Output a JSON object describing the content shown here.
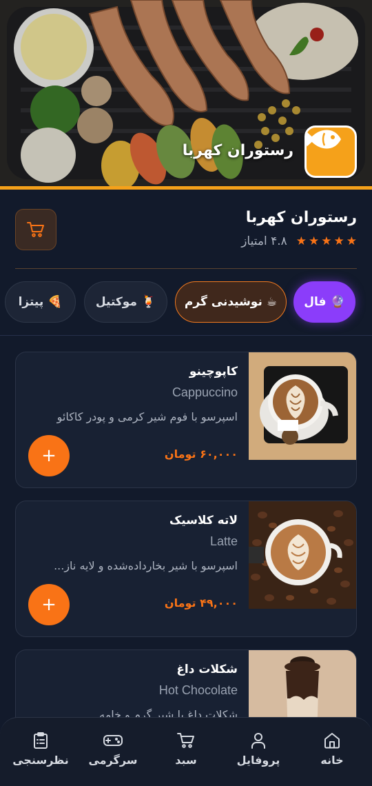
{
  "header": {
    "restaurant_name": "رستوران کهربا",
    "logo_icon": "fish-icon"
  },
  "info": {
    "name": "رستوران کهربا",
    "rating": "۴.۸",
    "rating_suffix": "امتیاز",
    "stars": 5,
    "cart_icon": "cart-icon"
  },
  "categories": [
    {
      "label": "فال",
      "emoji": "🔮",
      "state": "highlight"
    },
    {
      "label": "نوشیدنی گرم",
      "emoji": "☕",
      "state": "selected"
    },
    {
      "label": "موکتیل",
      "emoji": "🍹",
      "state": "normal"
    },
    {
      "label": "پیتزا",
      "emoji": "🍕",
      "state": "normal"
    }
  ],
  "menu": [
    {
      "title": "کاپوچینو",
      "english": "Cappuccino",
      "description": "اسپرسو با فوم شیر کرمی و پودر کاکائو",
      "price": "۶۰,۰۰۰ تومان",
      "add_label": "+"
    },
    {
      "title": "لاته کلاسیک",
      "english": "Latte",
      "description": "اسپرسو با شیر بخارداده‌شده و لایه ناز...",
      "price": "۴۹,۰۰۰ تومان",
      "add_label": "+"
    },
    {
      "title": "شکلات داغ",
      "english": "Hot Chocolate",
      "description": "شکلات داغ با شیر گرم و خامه",
      "price": "",
      "add_label": "+"
    }
  ],
  "nav": {
    "home": "خانه",
    "profile": "پروفایل",
    "cart": "سبد",
    "games": "سرگرمی",
    "survey": "نظرسنجی"
  },
  "colors": {
    "accent": "#f97316",
    "brand": "#f5a11a",
    "purple": "#8b3dfa",
    "background": "#121a2b"
  }
}
